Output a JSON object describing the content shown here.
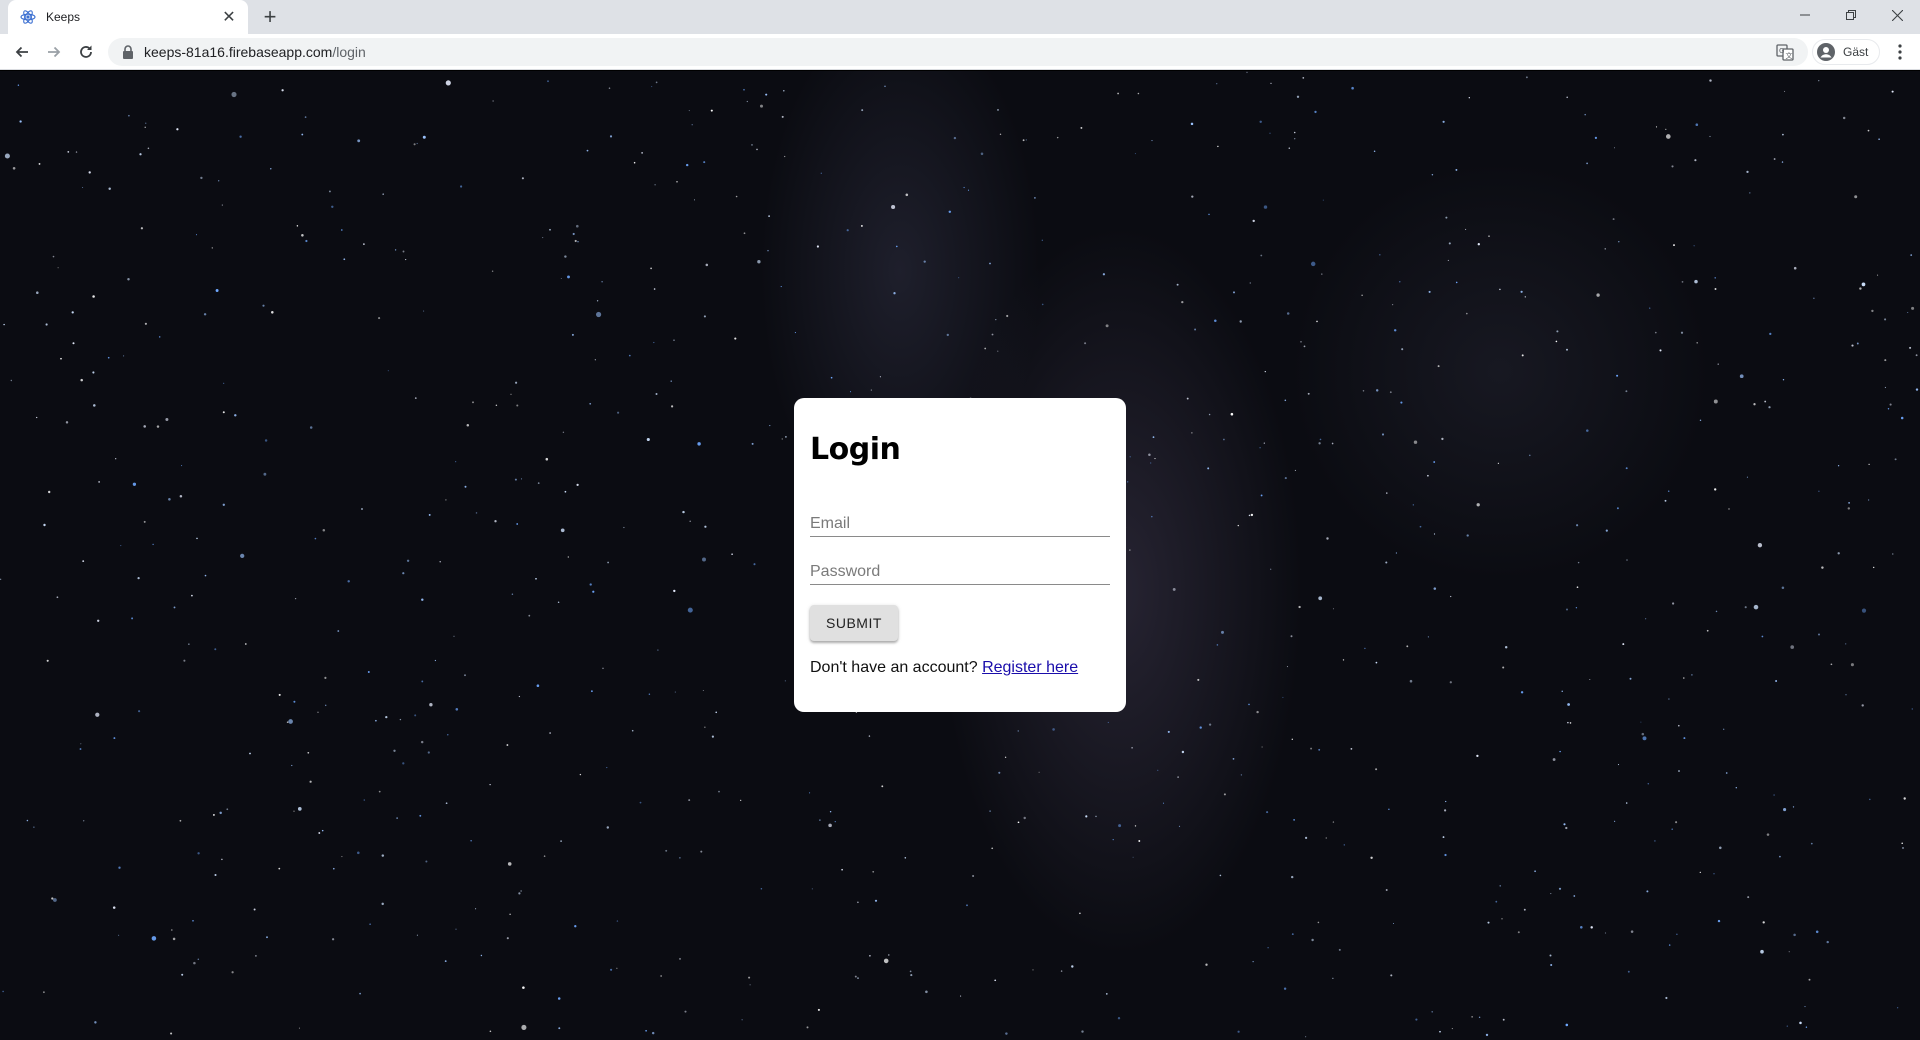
{
  "browser": {
    "tab": {
      "title": "Keeps",
      "close_glyph": "✕",
      "favicon": "react-atom-icon"
    },
    "new_tab_glyph": "+",
    "window_controls": {
      "minimize": "—",
      "maximize": "❐",
      "close": "✕"
    },
    "address": {
      "host": "keeps-81a16.firebaseapp.com",
      "path": "/login"
    },
    "profile": {
      "label": "Gäst"
    },
    "colors": {
      "favicon": "#3b6fd1"
    }
  },
  "page": {
    "login": {
      "title": "Login",
      "email_placeholder": "Email",
      "password_placeholder": "Password",
      "submit_label": "SUBMIT",
      "register_prompt": "Don't have an account?",
      "register_link": "Register here"
    },
    "colors": {
      "background": "#0b0c12",
      "card": "#ffffff",
      "link": "#1a0dab",
      "button": "#e0e0e0"
    }
  }
}
